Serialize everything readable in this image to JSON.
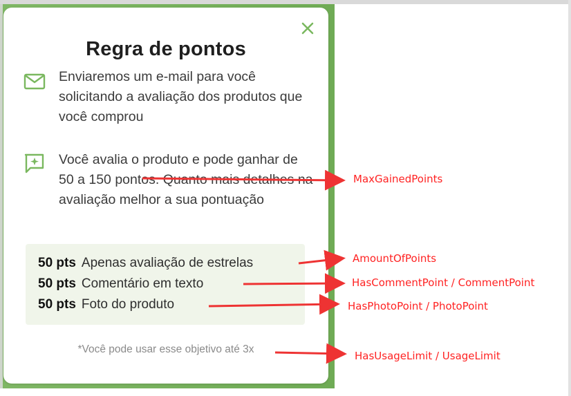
{
  "modal": {
    "title": "Regra de pontos",
    "close_icon": "close-x-icon",
    "email_icon": "mail-icon",
    "email_text": "Enviaremos um e-mail para você solicitando a avaliação dos produtos que você comprou",
    "review_icon": "sparkle-comment-icon",
    "review_text": "Você avalia o produto e pode ganhar de 50 a 150 pontos. Quanto mais detalhes na avaliação melhor a sua pontuação",
    "points": [
      {
        "pts": "50 pts",
        "label": "Apenas avaliação de estrelas"
      },
      {
        "pts": "50 pts",
        "label": "Comentário em texto"
      },
      {
        "pts": "50 pts",
        "label": "Foto do produto"
      }
    ],
    "usage_note": "*Você pode usar esse objetivo até 3x"
  },
  "annotations": {
    "max_gained": "MaxGainedPoints",
    "amount": "AmountOfPoints",
    "comment": "HasCommentPoint / CommentPoint",
    "photo": "HasPhotoPoint / PhotoPoint",
    "usage": "HasUsageLimit / UsageLimit"
  },
  "colors": {
    "brand_green": "#7ab85f",
    "annotation_red": "#ff2222",
    "points_box_bg": "#f0f5ea"
  }
}
